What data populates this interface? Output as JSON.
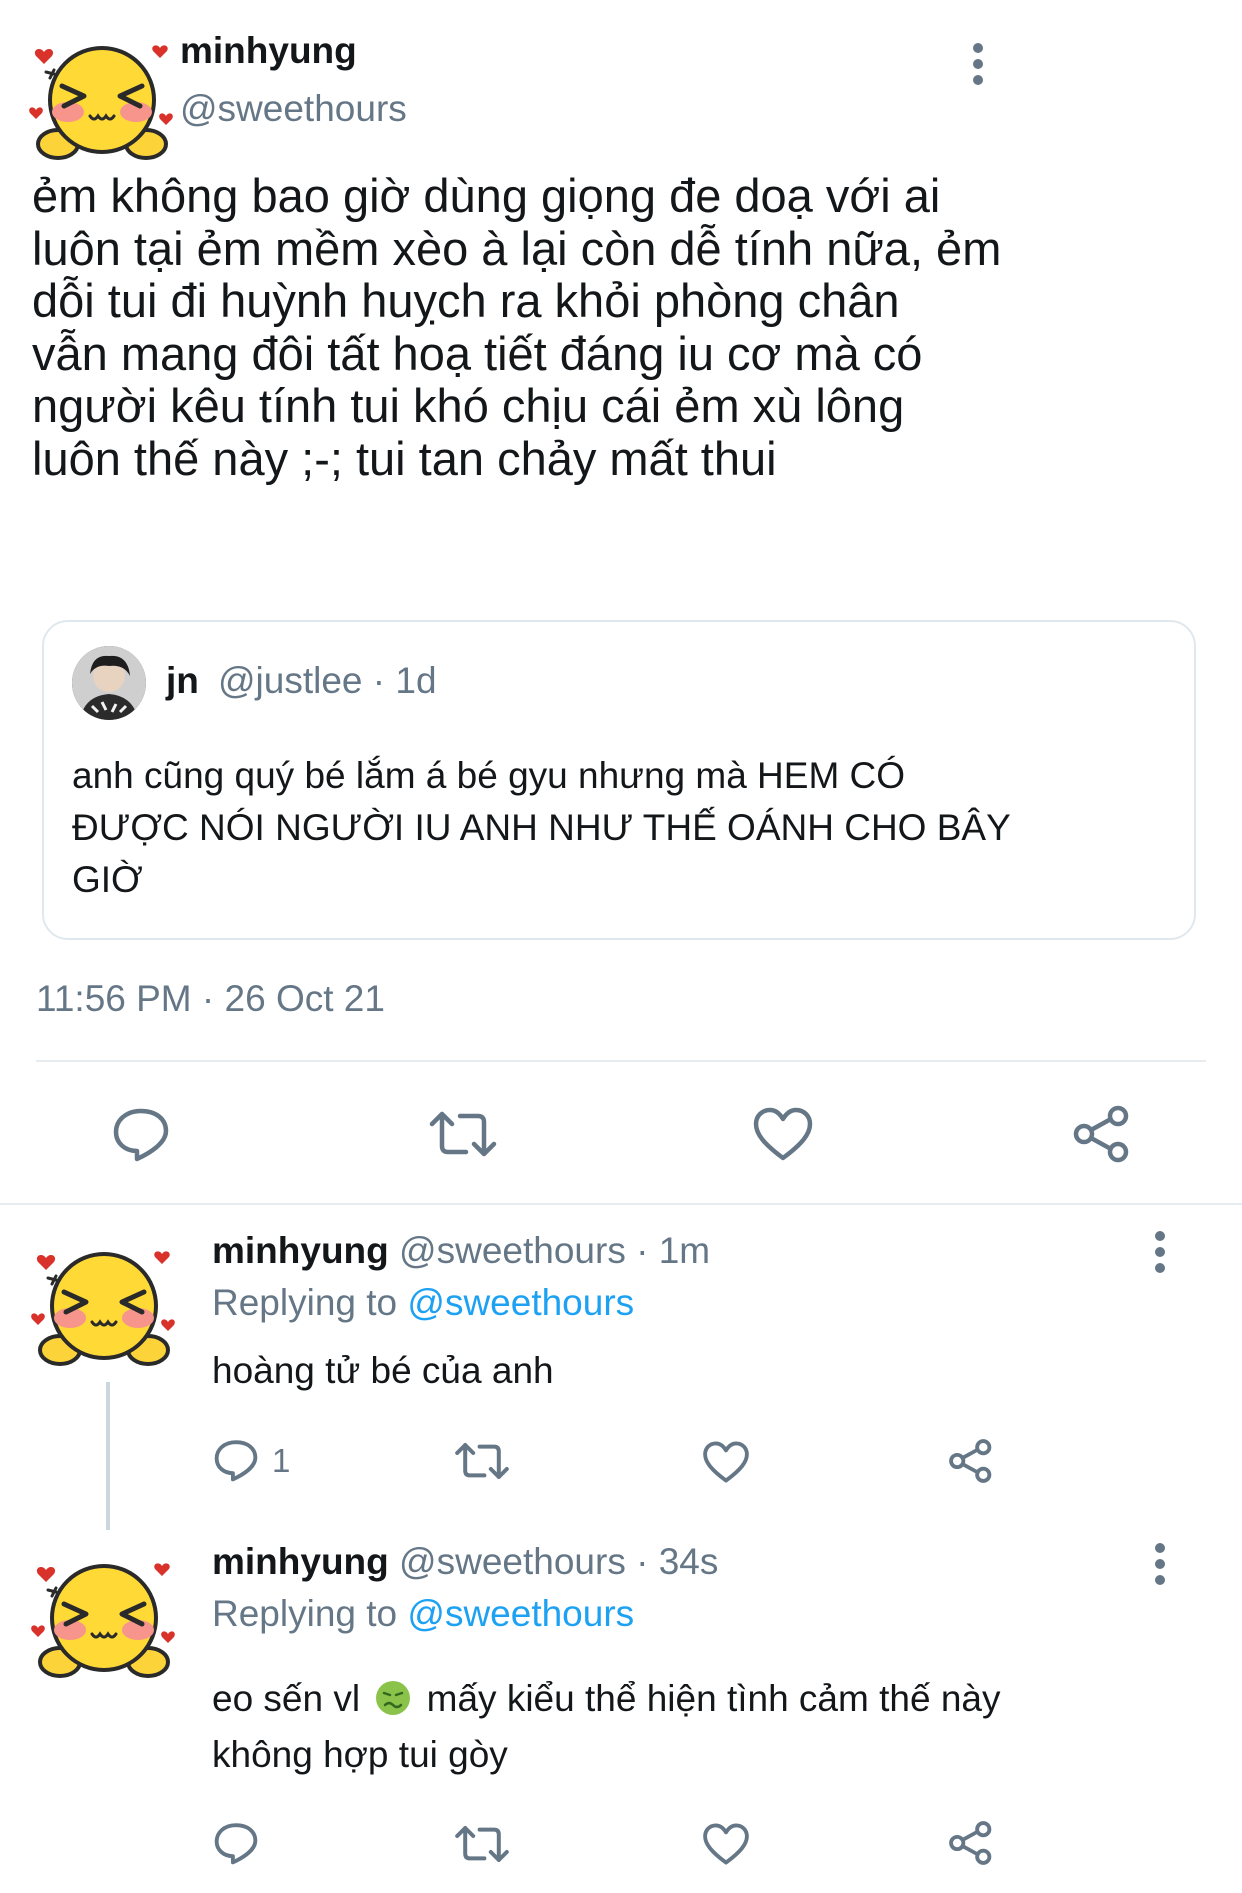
{
  "main_tweet": {
    "display_name": "minhyung",
    "handle": "@sweethours",
    "text_lines": [
      "ẻm không bao giờ dùng giọng đe doạ với ai",
      "luôn tại ẻm mềm xèo à lại còn dễ tính nữa, ẻm",
      "dỗi tui đi huỳnh huỵch ra khỏi phòng chân",
      "vẫn mang đôi tất hoạ tiết đáng iu cơ mà có",
      "người kêu tính tui khó chịu cái ẻm xù lông",
      "luôn thế này ;-; tui tan chảy mất thui"
    ],
    "timestamp": "11:56 PM · 26 Oct 21"
  },
  "quoted_tweet": {
    "display_name": "jn",
    "handle_time": "@justlee · 1d",
    "text_lines": [
      "anh cũng quý bé lắm á bé gyu nhưng mà HEM CÓ",
      "ĐƯỢC NÓI NGƯỜI IU ANH NHƯ THẾ OÁNH CHO BÂY",
      "GIỜ"
    ]
  },
  "action_bar_icons": [
    "reply-icon",
    "retweet-icon",
    "like-icon",
    "share-icon"
  ],
  "replies": [
    {
      "display_name": "minhyung",
      "handle_time": "@sweethours · 1m",
      "replying_prefix": "Replying to",
      "replying_handle": "@sweethours",
      "text_lines": [
        "hoàng tử bé của anh"
      ],
      "reply_count": "1"
    },
    {
      "display_name": "minhyung",
      "handle_time": "@sweethours · 34s",
      "replying_prefix": "Replying to",
      "replying_handle": "@sweethours",
      "text_lines": [
        "eo sến vl",
        "mấy kiểu thể hiện tình cảm thế này",
        "không hợp tui gòy"
      ],
      "emoji": "nauseated-face",
      "reply_count": ""
    }
  ],
  "colors": {
    "text": "#14171a",
    "muted": "#657786",
    "link": "#1da1f2",
    "icon": "#657786",
    "divider": "#e6ecf0"
  }
}
